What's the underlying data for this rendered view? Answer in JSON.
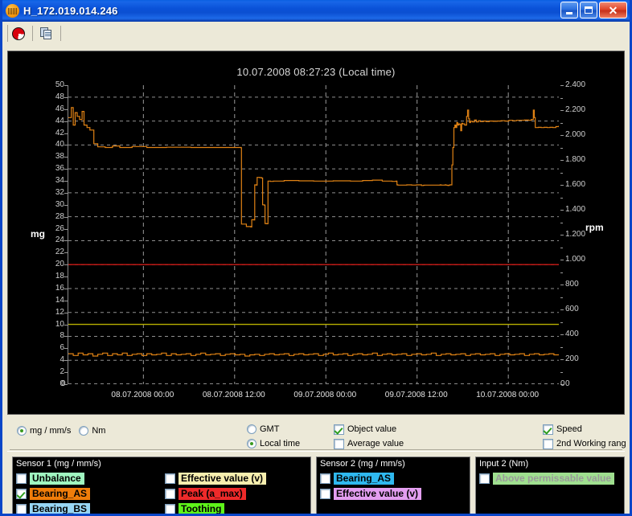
{
  "window": {
    "title": "H_172.019.014.246",
    "icon": "app-bridge-icon",
    "buttons": {
      "minimize": "minimize-icon",
      "maximize": "maximize-icon",
      "close": "close-icon"
    }
  },
  "toolbar": {
    "items": [
      {
        "name": "pie-chart-icon",
        "tooltip": "Diagram"
      },
      {
        "name": "copy-icon",
        "tooltip": "Copy"
      }
    ]
  },
  "chart_data": {
    "type": "line",
    "title": "10.07.2008 08:27:23 (Local time)",
    "xlabel": "",
    "ylabel": "mg",
    "y2label": "rpm",
    "xlim": [
      "08.07.2008 00:00",
      "10.07.2008 06:00"
    ],
    "ylim": [
      0,
      50
    ],
    "y2lim": [
      0,
      2400
    ],
    "grid": true,
    "legend_position": "bottom",
    "y_ticks": [
      0,
      2,
      4,
      6,
      8,
      10,
      12,
      14,
      16,
      18,
      20,
      22,
      24,
      26,
      28,
      30,
      32,
      34,
      36,
      38,
      40,
      42,
      44,
      46,
      48,
      50
    ],
    "y2_ticks": [
      "0",
      "200",
      "400",
      "600",
      "800",
      "1.000",
      "1.200",
      "1.400",
      "1.600",
      "1.800",
      "2.000",
      "2.200",
      "2.400"
    ],
    "x_ticks": [
      "08.07.2008 00:00",
      "08.07.2008 12:00",
      "09.07.2008 00:00",
      "09.07.2008 12:00",
      "10.07.2008 00:00"
    ],
    "x_tick_positions": [
      0.153,
      0.339,
      0.525,
      0.711,
      0.897
    ],
    "series": [
      {
        "name": "Speed",
        "color": "#e08214",
        "axis": "right",
        "unit": "rpm",
        "points": [
          [
            0.0,
            2140
          ],
          [
            0.006,
            2220
          ],
          [
            0.01,
            2080
          ],
          [
            0.014,
            2180
          ],
          [
            0.018,
            2150
          ],
          [
            0.023,
            2125
          ],
          [
            0.028,
            2190
          ],
          [
            0.032,
            2080
          ],
          [
            0.038,
            2060
          ],
          [
            0.044,
            2040
          ],
          [
            0.052,
            1930
          ],
          [
            0.06,
            1905
          ],
          [
            0.075,
            1900
          ],
          [
            0.09,
            1912
          ],
          [
            0.105,
            1900
          ],
          [
            0.13,
            1908
          ],
          [
            0.16,
            1900
          ],
          [
            0.2,
            1902
          ],
          [
            0.25,
            1900
          ],
          [
            0.3,
            1900
          ],
          [
            0.34,
            1900
          ],
          [
            0.352,
            1898
          ],
          [
            0.353,
            1285
          ],
          [
            0.363,
            1265
          ],
          [
            0.372,
            1262
          ],
          [
            0.374,
            1320
          ],
          [
            0.378,
            1318
          ],
          [
            0.38,
            1600
          ],
          [
            0.383,
            1598
          ],
          [
            0.385,
            1660
          ],
          [
            0.39,
            1658
          ],
          [
            0.394,
            1655
          ],
          [
            0.396,
            1440
          ],
          [
            0.399,
            1438
          ],
          [
            0.401,
            1290
          ],
          [
            0.404,
            1288
          ],
          [
            0.407,
            1630
          ],
          [
            0.412,
            1628
          ],
          [
            0.418,
            1630
          ],
          [
            0.44,
            1635
          ],
          [
            0.47,
            1632
          ],
          [
            0.5,
            1630
          ],
          [
            0.54,
            1632
          ],
          [
            0.575,
            1630
          ],
          [
            0.6,
            1635
          ],
          [
            0.62,
            1638
          ],
          [
            0.64,
            1630
          ],
          [
            0.66,
            1628
          ],
          [
            0.668,
            1630
          ],
          [
            0.67,
            1600
          ],
          [
            0.672,
            1598
          ],
          [
            0.69,
            1600
          ],
          [
            0.7,
            1598
          ],
          [
            0.71,
            1600
          ],
          [
            0.718,
            1600
          ],
          [
            0.72,
            1595
          ],
          [
            0.722,
            1595
          ],
          [
            0.724,
            1597
          ],
          [
            0.726,
            1598
          ],
          [
            0.74,
            1598
          ],
          [
            0.75,
            1598
          ],
          [
            0.752,
            1598
          ],
          [
            0.754,
            1598
          ],
          [
            0.756,
            1598
          ],
          [
            0.758,
            1600
          ],
          [
            0.76,
            1598
          ],
          [
            0.762,
            1598
          ],
          [
            0.764,
            1598
          ],
          [
            0.766,
            1598
          ],
          [
            0.768,
            1600
          ],
          [
            0.77,
            1598
          ],
          [
            0.772,
            1597
          ],
          [
            0.774,
            1595
          ],
          [
            0.776,
            1598
          ],
          [
            0.778,
            1600
          ],
          [
            0.782,
            1760
          ],
          [
            0.784,
            1900
          ],
          [
            0.786,
            2060
          ],
          [
            0.788,
            2080
          ],
          [
            0.79,
            2060
          ],
          [
            0.792,
            2100
          ],
          [
            0.794,
            2080
          ],
          [
            0.796,
            2090
          ],
          [
            0.798,
            2085
          ],
          [
            0.8,
            2035
          ],
          [
            0.802,
            2095
          ],
          [
            0.804,
            2090
          ],
          [
            0.808,
            2080
          ],
          [
            0.812,
            2150
          ],
          [
            0.814,
            2200
          ],
          [
            0.816,
            2130
          ],
          [
            0.818,
            2100
          ],
          [
            0.82,
            2110
          ],
          [
            0.824,
            2105
          ],
          [
            0.828,
            2120
          ],
          [
            0.832,
            2105
          ],
          [
            0.836,
            2115
          ],
          [
            0.84,
            2108
          ],
          [
            0.846,
            2112
          ],
          [
            0.852,
            2108
          ],
          [
            0.858,
            2112
          ],
          [
            0.866,
            2110
          ],
          [
            0.874,
            2112
          ],
          [
            0.882,
            2115
          ],
          [
            0.89,
            2112
          ],
          [
            0.898,
            2118
          ],
          [
            0.906,
            2115
          ],
          [
            0.914,
            2118
          ],
          [
            0.922,
            2118
          ],
          [
            0.93,
            2120
          ],
          [
            0.938,
            2118
          ],
          [
            0.944,
            2125
          ],
          [
            0.948,
            2200
          ],
          [
            0.95,
            2140
          ],
          [
            0.952,
            2060
          ],
          [
            0.954,
            2060
          ],
          [
            0.958,
            2062
          ],
          [
            0.964,
            2060
          ],
          [
            0.97,
            2062
          ],
          [
            0.976,
            2060
          ],
          [
            0.982,
            2062
          ],
          [
            0.988,
            2060
          ],
          [
            0.994,
            2068
          ],
          [
            1.0,
            2075
          ]
        ]
      },
      {
        "name": "Bearing_AS",
        "color": "#e08214",
        "axis": "left",
        "unit": "mg",
        "points": [
          [
            0.0,
            5.1
          ],
          [
            0.01,
            4.8
          ],
          [
            0.02,
            5.2
          ],
          [
            0.03,
            4.9
          ],
          [
            0.04,
            5.1
          ],
          [
            0.05,
            4.7
          ],
          [
            0.06,
            5.0
          ],
          [
            0.07,
            5.2
          ],
          [
            0.08,
            4.8
          ],
          [
            0.09,
            5.1
          ],
          [
            0.1,
            4.9
          ],
          [
            0.11,
            5.2
          ],
          [
            0.12,
            4.8
          ],
          [
            0.13,
            5.0
          ],
          [
            0.14,
            5.1
          ],
          [
            0.15,
            4.8
          ],
          [
            0.16,
            5.1
          ],
          [
            0.17,
            4.9
          ],
          [
            0.18,
            5.0
          ],
          [
            0.19,
            5.2
          ],
          [
            0.2,
            4.8
          ],
          [
            0.21,
            5.1
          ],
          [
            0.22,
            4.9
          ],
          [
            0.23,
            5.0
          ],
          [
            0.24,
            5.1
          ],
          [
            0.25,
            4.8
          ],
          [
            0.26,
            5.0
          ],
          [
            0.27,
            5.2
          ],
          [
            0.28,
            4.9
          ],
          [
            0.29,
            5.0
          ],
          [
            0.3,
            5.1
          ],
          [
            0.31,
            4.8
          ],
          [
            0.32,
            5.0
          ],
          [
            0.33,
            5.1
          ],
          [
            0.34,
            4.9
          ],
          [
            0.35,
            5.0
          ],
          [
            0.36,
            4.7
          ],
          [
            0.37,
            4.9
          ],
          [
            0.38,
            5.0
          ],
          [
            0.39,
            4.8
          ],
          [
            0.4,
            5.0
          ],
          [
            0.41,
            5.1
          ],
          [
            0.42,
            4.9
          ],
          [
            0.43,
            5.0
          ],
          [
            0.44,
            5.1
          ],
          [
            0.45,
            4.8
          ],
          [
            0.46,
            5.0
          ],
          [
            0.47,
            5.1
          ],
          [
            0.48,
            4.9
          ],
          [
            0.49,
            5.0
          ],
          [
            0.5,
            5.1
          ],
          [
            0.51,
            4.8
          ],
          [
            0.52,
            5.0
          ],
          [
            0.53,
            5.2
          ],
          [
            0.54,
            4.9
          ],
          [
            0.55,
            5.0
          ],
          [
            0.56,
            5.1
          ],
          [
            0.57,
            4.8
          ],
          [
            0.58,
            5.0
          ],
          [
            0.59,
            5.1
          ],
          [
            0.6,
            4.9
          ],
          [
            0.61,
            5.0
          ],
          [
            0.62,
            5.2
          ],
          [
            0.63,
            4.8
          ],
          [
            0.64,
            5.0
          ],
          [
            0.65,
            5.1
          ],
          [
            0.66,
            4.9
          ],
          [
            0.67,
            5.0
          ],
          [
            0.68,
            5.1
          ],
          [
            0.69,
            4.8
          ],
          [
            0.7,
            5.0
          ],
          [
            0.71,
            5.1
          ],
          [
            0.72,
            4.9
          ],
          [
            0.73,
            5.0
          ],
          [
            0.74,
            5.2
          ],
          [
            0.75,
            4.8
          ],
          [
            0.76,
            5.0
          ],
          [
            0.77,
            5.1
          ],
          [
            0.78,
            4.9
          ],
          [
            0.79,
            5.0
          ],
          [
            0.8,
            5.1
          ],
          [
            0.81,
            4.8
          ],
          [
            0.82,
            5.0
          ],
          [
            0.83,
            5.1
          ],
          [
            0.84,
            4.9
          ],
          [
            0.85,
            5.0
          ],
          [
            0.86,
            5.1
          ],
          [
            0.87,
            4.8
          ],
          [
            0.88,
            5.0
          ],
          [
            0.89,
            5.1
          ],
          [
            0.9,
            4.9
          ],
          [
            0.91,
            5.0
          ],
          [
            0.92,
            5.1
          ],
          [
            0.93,
            4.8
          ],
          [
            0.94,
            5.0
          ],
          [
            0.95,
            5.1
          ],
          [
            0.96,
            4.9
          ],
          [
            0.97,
            5.0
          ],
          [
            0.98,
            5.1
          ],
          [
            0.99,
            4.9
          ],
          [
            1.0,
            5.0
          ]
        ]
      }
    ],
    "threshold_lines": [
      {
        "name": "alarm-limit",
        "value": 20,
        "axis": "left",
        "color": "#cc1a16"
      },
      {
        "name": "warning-limit",
        "value": 10,
        "axis": "left",
        "color": "#b8b000"
      }
    ]
  },
  "options": {
    "unit_group": [
      {
        "label": "mg / mm/s",
        "selected": true
      },
      {
        "label": "Nm",
        "selected": false
      }
    ],
    "time_group": [
      {
        "label": "GMT",
        "selected": false
      },
      {
        "label": "Local time",
        "selected": true
      }
    ],
    "value_group": [
      {
        "label": "Object value",
        "checked": true
      },
      {
        "label": "Average value",
        "checked": false
      }
    ],
    "speed_group": [
      {
        "label": "Speed",
        "checked": true
      },
      {
        "label": "2nd Working rang",
        "checked": false
      }
    ]
  },
  "panels": [
    {
      "name": "sensor-1",
      "title": "Sensor 1 (mg / mm/s)",
      "columns": [
        [
          {
            "label": "Unbalance",
            "checked": false,
            "color": "#9ff5c0",
            "disabled": false
          },
          {
            "label": "Bearing_AS",
            "checked": true,
            "color": "#f07d0a",
            "disabled": false
          },
          {
            "label": "Bearing_BS",
            "checked": false,
            "color": "#97d6f5",
            "disabled": false
          }
        ],
        [
          {
            "label": "Effective value (v)",
            "checked": false,
            "color": "#f7eeae",
            "disabled": false
          },
          {
            "label": "Peak (a_max)",
            "checked": false,
            "color": "#ef2a2a",
            "disabled": false
          },
          {
            "label": "Toothing",
            "checked": false,
            "color": "#5ef51a",
            "disabled": false
          }
        ]
      ]
    },
    {
      "name": "sensor-2",
      "title": "Sensor 2 (mg / mm/s)",
      "columns": [
        [
          {
            "label": "Bearing_AS",
            "checked": false,
            "color": "#2fb8ef",
            "disabled": false
          },
          {
            "label": "Effective value (v)",
            "checked": false,
            "color": "#e39ef0",
            "disabled": false
          }
        ]
      ]
    },
    {
      "name": "input-2",
      "title": "Input 2 (Nm)",
      "columns": [
        [
          {
            "label": "Above permissable value",
            "checked": false,
            "color": "#9fdf8f",
            "disabled": true
          }
        ]
      ]
    }
  ]
}
